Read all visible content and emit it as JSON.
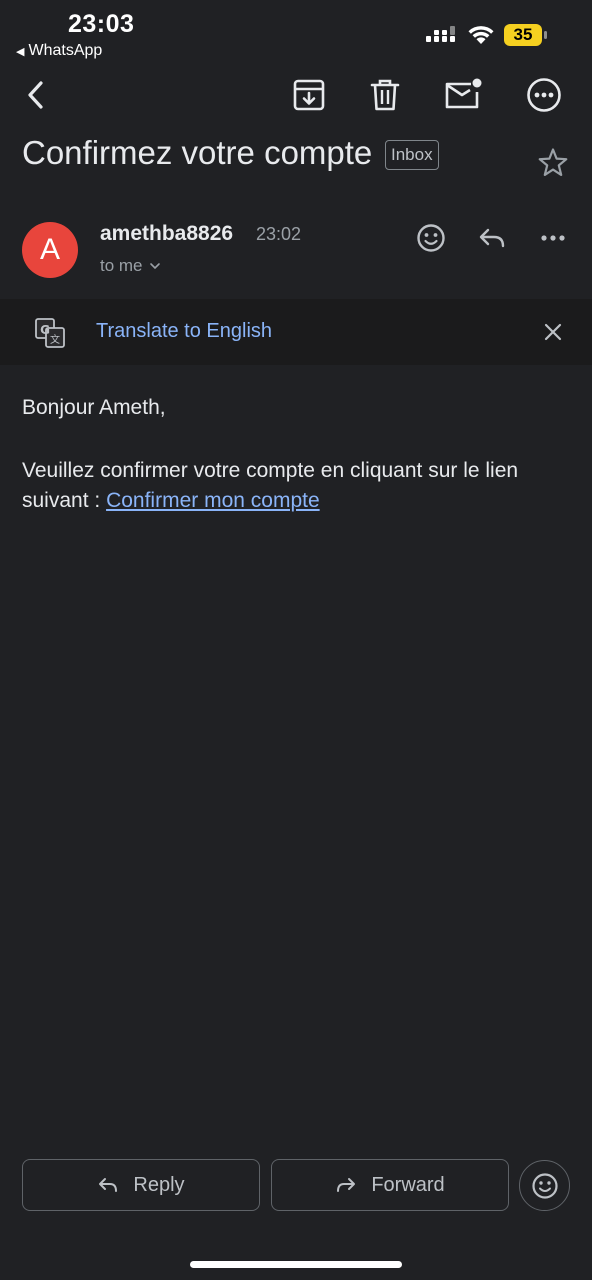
{
  "status_bar": {
    "time": "23:03",
    "back_app": "WhatsApp",
    "battery": "35",
    "battery_color": "#f5d020"
  },
  "toolbar": {
    "icons": [
      "back-arrow-icon",
      "archive-icon",
      "trash-icon",
      "mark-unread-icon",
      "more-options-icon"
    ]
  },
  "email": {
    "subject": "Confirmez votre compte",
    "label": "Inbox",
    "sender": "amethba8826",
    "sender_initial": "A",
    "avatar_color": "#e8453c",
    "time": "23:02",
    "recipient": "to me"
  },
  "translate": {
    "link": "Translate to English"
  },
  "body": {
    "greeting": "Bonjour Ameth,",
    "message": "Veuillez confirmer votre compte en cliquant sur le lien suivant :",
    "link_text": "Confirmer mon compte",
    "link_color": "#8ab4f8"
  },
  "actions": {
    "reply": "Reply",
    "forward": "Forward"
  }
}
